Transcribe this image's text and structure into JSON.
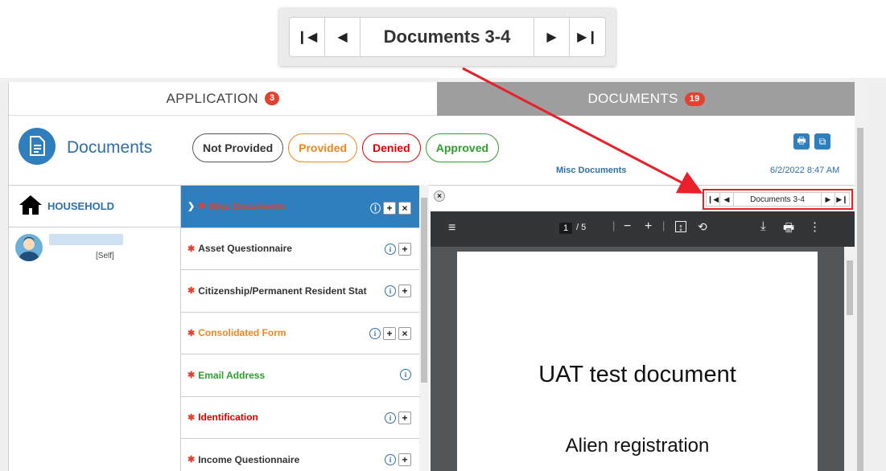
{
  "zoom_pager": {
    "first": "⏮",
    "prev": "◀",
    "label": "Documents 3-4",
    "next": "▶",
    "last": "⏭"
  },
  "tabs": {
    "application_label": "APPLICATION",
    "application_count": "3",
    "documents_label": "DOCUMENTS",
    "documents_count": "19"
  },
  "header": {
    "title": "Documents",
    "misc_link": "Misc Documents",
    "date": "6/2/2022 8:47 AM"
  },
  "filters": [
    {
      "label": "Not Provided",
      "color": "#555555"
    },
    {
      "label": "Provided",
      "color": "#f0871e"
    },
    {
      "label": "Denied",
      "color": "#e00000"
    },
    {
      "label": "Approved",
      "color": "#2e9e2e"
    }
  ],
  "household": {
    "heading": "HOUSEHOLD",
    "member_role": "[Self]"
  },
  "documents": [
    {
      "label": "Misc Documents",
      "color": "#e4412f",
      "active": true
    },
    {
      "label": "Asset Questionnaire",
      "color": "#333333"
    },
    {
      "label": "Citizenship/Permanent Resident Stat",
      "color": "#333333"
    },
    {
      "label": "Consolidated Form",
      "color": "#f0871e"
    },
    {
      "label": "Email Address",
      "color": "#2e9e2e"
    },
    {
      "label": "Identification",
      "color": "#e00000"
    },
    {
      "label": "Income Questionnaire",
      "color": "#333333"
    }
  ],
  "viewer_pager": {
    "label": "Documents 3-4"
  },
  "pdf": {
    "page_current": "1",
    "page_total": "/ 5",
    "title": "UAT test document",
    "subtitle": "Alien registration"
  }
}
